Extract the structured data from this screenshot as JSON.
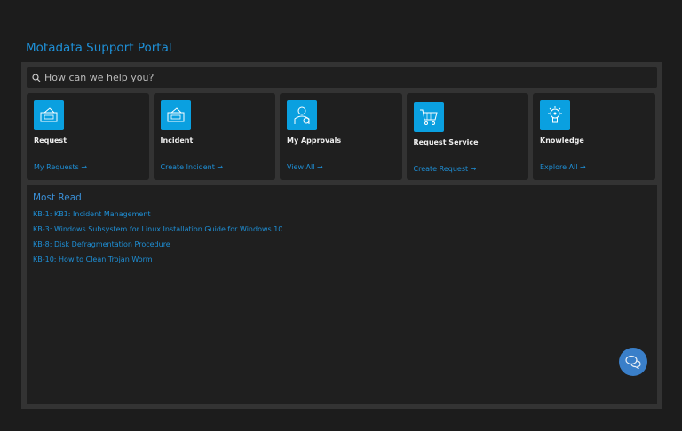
{
  "header": {
    "title": "Motadata Support Portal"
  },
  "search": {
    "placeholder": "How can we help you?"
  },
  "cards": [
    {
      "label": "Request",
      "link": "My Requests →",
      "icon": "ticket-icon"
    },
    {
      "label": "Incident",
      "link": "Create Incident →",
      "icon": "ticket-icon"
    },
    {
      "label": "My Approvals",
      "link": "View All →",
      "icon": "approver-icon"
    },
    {
      "label": "Request Service",
      "link": "Create Request →",
      "icon": "cart-icon"
    },
    {
      "label": "Knowledge",
      "link": "Explore All →",
      "icon": "lightbulb-icon"
    }
  ],
  "most_read": {
    "title": "Most Read",
    "items": [
      "KB-1: KB1: Incident Management",
      "KB-3: Windows Subsystem for Linux Installation Guide for Windows 10",
      "KB-8: Disk Defragmentation Procedure",
      "KB-10: How to Clean Trojan Worm"
    ]
  },
  "colors": {
    "accent": "#1e8fd6",
    "icon_bg": "#0aa0e0",
    "chat": "#3a7fc9"
  }
}
